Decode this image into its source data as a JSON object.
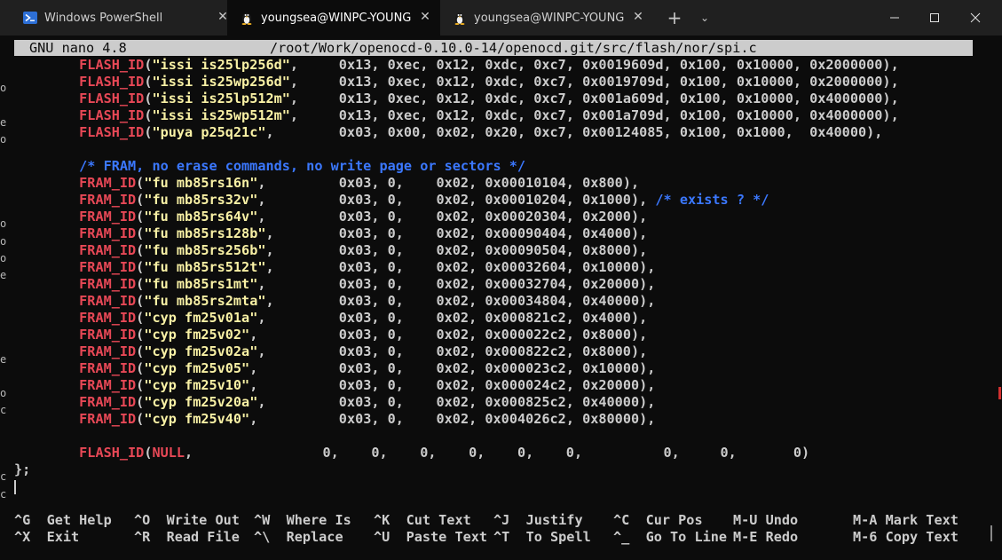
{
  "tabs": [
    {
      "title": "Windows PowerShell",
      "icon": "powershell-icon",
      "active": false
    },
    {
      "title": "youngsea@WINPC-YOUNGSEA:",
      "icon": "linux-penguin-icon",
      "active": true
    },
    {
      "title": "youngsea@WINPC-YOUNGSEA:",
      "icon": "linux-penguin-icon",
      "active": false
    }
  ],
  "tab_close_glyph": "✕",
  "new_tab_glyph": "+",
  "dropdown_glyph": "⌄",
  "nano": {
    "version": "GNU nano 4.8",
    "path": "/root/Work/openocd-0.10.0-14/openocd.git/src/flash/nor/spi.c"
  },
  "code_lines": [
    [
      [
        "",
        "        "
      ],
      [
        "kw",
        "FLASH_ID"
      ],
      [
        "",
        "("
      ],
      [
        "str",
        "\"issi is25lp256d\""
      ],
      [
        "",
        ",     "
      ],
      [
        "num",
        "0x13, 0xec, 0x12, 0xdc, 0xc7, 0x0019609d, 0x100, 0x10000, 0x2000000"
      ],
      [
        "",
        "),"
      ]
    ],
    [
      [
        "",
        "        "
      ],
      [
        "kw",
        "FLASH_ID"
      ],
      [
        "",
        "("
      ],
      [
        "str",
        "\"issi is25wp256d\""
      ],
      [
        "",
        ",     "
      ],
      [
        "num",
        "0x13, 0xec, 0x12, 0xdc, 0xc7, 0x0019709d, 0x100, 0x10000, 0x2000000"
      ],
      [
        "",
        "),"
      ]
    ],
    [
      [
        "",
        "        "
      ],
      [
        "kw",
        "FLASH_ID"
      ],
      [
        "",
        "("
      ],
      [
        "str",
        "\"issi is25lp512m\""
      ],
      [
        "",
        ",     "
      ],
      [
        "num",
        "0x13, 0xec, 0x12, 0xdc, 0xc7, 0x001a609d, 0x100, 0x10000, 0x4000000"
      ],
      [
        "",
        "),"
      ]
    ],
    [
      [
        "",
        "        "
      ],
      [
        "kw",
        "FLASH_ID"
      ],
      [
        "",
        "("
      ],
      [
        "str",
        "\"issi is25wp512m\""
      ],
      [
        "",
        ",     "
      ],
      [
        "num",
        "0x13, 0xec, 0x12, 0xdc, 0xc7, 0x001a709d, 0x100, 0x10000, 0x4000000"
      ],
      [
        "",
        "),"
      ]
    ],
    [
      [
        "",
        "        "
      ],
      [
        "kw",
        "FLASH_ID"
      ],
      [
        "",
        "("
      ],
      [
        "str",
        "\"puya p25q21c\""
      ],
      [
        "",
        ",        "
      ],
      [
        "num",
        "0x03, 0x00, 0x02, 0x20, 0xc7, 0x00124085, 0x100, 0x1000,  0x40000"
      ],
      [
        "",
        "),"
      ]
    ],
    [],
    [
      [
        "",
        "        "
      ],
      [
        "cm",
        "/* FRAM, no erase commands, no write page or sectors */"
      ]
    ],
    [
      [
        "",
        "        "
      ],
      [
        "kw",
        "FRAM_ID"
      ],
      [
        "",
        "("
      ],
      [
        "str",
        "\"fu mb85rs16n\""
      ],
      [
        "",
        ",         "
      ],
      [
        "num",
        "0x03, 0,    0x02, 0x00010104, 0x800"
      ],
      [
        "",
        "),"
      ]
    ],
    [
      [
        "",
        "        "
      ],
      [
        "kw",
        "FRAM_ID"
      ],
      [
        "",
        "("
      ],
      [
        "str",
        "\"fu mb85rs32v\""
      ],
      [
        "",
        ",         "
      ],
      [
        "num",
        "0x03, 0,    0x02, 0x00010204, 0x1000"
      ],
      [
        "",
        "), "
      ],
      [
        "cm",
        "/* exists ? */"
      ]
    ],
    [
      [
        "",
        "        "
      ],
      [
        "kw",
        "FRAM_ID"
      ],
      [
        "",
        "("
      ],
      [
        "str",
        "\"fu mb85rs64v\""
      ],
      [
        "",
        ",         "
      ],
      [
        "num",
        "0x03, 0,    0x02, 0x00020304, 0x2000"
      ],
      [
        "",
        "),"
      ]
    ],
    [
      [
        "",
        "        "
      ],
      [
        "kw",
        "FRAM_ID"
      ],
      [
        "",
        "("
      ],
      [
        "str",
        "\"fu mb85rs128b\""
      ],
      [
        "",
        ",        "
      ],
      [
        "num",
        "0x03, 0,    0x02, 0x00090404, 0x4000"
      ],
      [
        "",
        "),"
      ]
    ],
    [
      [
        "",
        "        "
      ],
      [
        "kw",
        "FRAM_ID"
      ],
      [
        "",
        "("
      ],
      [
        "str",
        "\"fu mb85rs256b\""
      ],
      [
        "",
        ",        "
      ],
      [
        "num",
        "0x03, 0,    0x02, 0x00090504, 0x8000"
      ],
      [
        "",
        "),"
      ]
    ],
    [
      [
        "",
        "        "
      ],
      [
        "kw",
        "FRAM_ID"
      ],
      [
        "",
        "("
      ],
      [
        "str",
        "\"fu mb85rs512t\""
      ],
      [
        "",
        ",        "
      ],
      [
        "num",
        "0x03, 0,    0x02, 0x00032604, 0x10000"
      ],
      [
        "",
        "),"
      ]
    ],
    [
      [
        "",
        "        "
      ],
      [
        "kw",
        "FRAM_ID"
      ],
      [
        "",
        "("
      ],
      [
        "str",
        "\"fu mb85rs1mt\""
      ],
      [
        "",
        ",         "
      ],
      [
        "num",
        "0x03, 0,    0x02, 0x00032704, 0x20000"
      ],
      [
        "",
        "),"
      ]
    ],
    [
      [
        "",
        "        "
      ],
      [
        "kw",
        "FRAM_ID"
      ],
      [
        "",
        "("
      ],
      [
        "str",
        "\"fu mb85rs2mta\""
      ],
      [
        "",
        ",        "
      ],
      [
        "num",
        "0x03, 0,    0x02, 0x00034804, 0x40000"
      ],
      [
        "",
        "),"
      ]
    ],
    [
      [
        "",
        "        "
      ],
      [
        "kw",
        "FRAM_ID"
      ],
      [
        "",
        "("
      ],
      [
        "str",
        "\"cyp fm25v01a\""
      ],
      [
        "",
        ",         "
      ],
      [
        "num",
        "0x03, 0,    0x02, 0x000821c2, 0x4000"
      ],
      [
        "",
        "),"
      ]
    ],
    [
      [
        "",
        "        "
      ],
      [
        "kw",
        "FRAM_ID"
      ],
      [
        "",
        "("
      ],
      [
        "str",
        "\"cyp fm25v02\""
      ],
      [
        "",
        ",          "
      ],
      [
        "num",
        "0x03, 0,    0x02, 0x000022c2, 0x8000"
      ],
      [
        "",
        "),"
      ]
    ],
    [
      [
        "",
        "        "
      ],
      [
        "kw",
        "FRAM_ID"
      ],
      [
        "",
        "("
      ],
      [
        "str",
        "\"cyp fm25v02a\""
      ],
      [
        "",
        ",         "
      ],
      [
        "num",
        "0x03, 0,    0x02, 0x000822c2, 0x8000"
      ],
      [
        "",
        "),"
      ]
    ],
    [
      [
        "",
        "        "
      ],
      [
        "kw",
        "FRAM_ID"
      ],
      [
        "",
        "("
      ],
      [
        "str",
        "\"cyp fm25v05\""
      ],
      [
        "",
        ",          "
      ],
      [
        "num",
        "0x03, 0,    0x02, 0x000023c2, 0x10000"
      ],
      [
        "",
        "),"
      ]
    ],
    [
      [
        "",
        "        "
      ],
      [
        "kw",
        "FRAM_ID"
      ],
      [
        "",
        "("
      ],
      [
        "str",
        "\"cyp fm25v10\""
      ],
      [
        "",
        ",          "
      ],
      [
        "num",
        "0x03, 0,    0x02, 0x000024c2, 0x20000"
      ],
      [
        "",
        "),"
      ]
    ],
    [
      [
        "",
        "        "
      ],
      [
        "kw",
        "FRAM_ID"
      ],
      [
        "",
        "("
      ],
      [
        "str",
        "\"cyp fm25v20a\""
      ],
      [
        "",
        ",         "
      ],
      [
        "num",
        "0x03, 0,    0x02, 0x000825c2, 0x40000"
      ],
      [
        "",
        "),"
      ]
    ],
    [
      [
        "",
        "        "
      ],
      [
        "kw",
        "FRAM_ID"
      ],
      [
        "",
        "("
      ],
      [
        "str",
        "\"cyp fm25v40\""
      ],
      [
        "",
        ",          "
      ],
      [
        "num",
        "0x03, 0,    0x02, 0x004026c2, 0x80000"
      ],
      [
        "",
        "),"
      ]
    ],
    [],
    [
      [
        "",
        "        "
      ],
      [
        "kw",
        "FLASH_ID"
      ],
      [
        "",
        "("
      ],
      [
        "nul",
        "NULL"
      ],
      [
        "",
        ",                "
      ],
      [
        "num",
        "0,    0,    0,    0,    0,    0,          0,     0,       0"
      ],
      [
        "",
        ")"
      ]
    ],
    [
      [
        "",
        "};"
      ]
    ]
  ],
  "left_edge_chars": [
    "o",
    "e",
    "o",
    "o",
    "o",
    "o",
    "e",
    "e",
    "o",
    "c",
    "c",
    "c"
  ],
  "shortcuts": [
    {
      "key": "^G",
      "label": "Get Help"
    },
    {
      "key": "^X",
      "label": "Exit"
    },
    {
      "key": "^O",
      "label": "Write Out"
    },
    {
      "key": "^R",
      "label": "Read File"
    },
    {
      "key": "^W",
      "label": "Where Is"
    },
    {
      "key": "^\\",
      "label": "Replace"
    },
    {
      "key": "^K",
      "label": "Cut Text"
    },
    {
      "key": "^U",
      "label": "Paste Text"
    },
    {
      "key": "^J",
      "label": "Justify"
    },
    {
      "key": "^T",
      "label": "To Spell"
    },
    {
      "key": "^C",
      "label": "Cur Pos"
    },
    {
      "key": "^_",
      "label": "Go To Line"
    },
    {
      "key": "M-U",
      "label": "Undo"
    },
    {
      "key": "M-E",
      "label": "Redo"
    },
    {
      "key": "M-A",
      "label": "Mark Text"
    },
    {
      "key": "M-6",
      "label": "Copy Text"
    }
  ],
  "colors": {
    "keyword": "#e74856",
    "string": "#f9f1a5",
    "comment": "#3b78ff",
    "text": "#cccccc",
    "background": "#0c0c0c",
    "titlebar": "#202020"
  }
}
